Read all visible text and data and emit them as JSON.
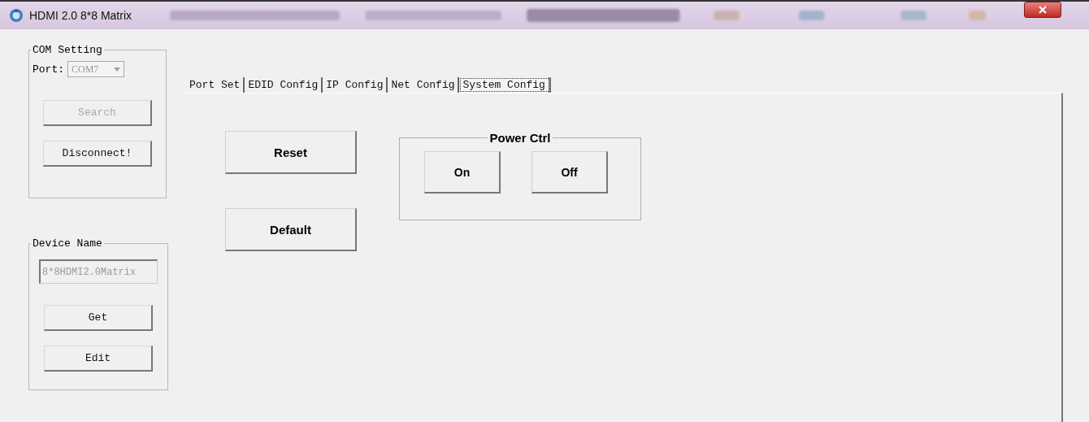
{
  "window": {
    "title": "HDMI 2.0 8*8 Matrix"
  },
  "com_setting": {
    "title": "COM Setting",
    "port_label": "Port:",
    "port_value": "COM7",
    "port_disabled": true,
    "buttons": [
      {
        "label": "Search",
        "disabled": true
      },
      {
        "label": "Disconnect!",
        "disabled": false
      }
    ]
  },
  "device_name": {
    "title": "Device Name",
    "value": "8*8HDMI2.0Matrix",
    "disabled": true,
    "buttons": [
      {
        "label": "Get",
        "disabled": false
      },
      {
        "label": "Edit",
        "disabled": false
      }
    ]
  },
  "tabs": [
    {
      "label": "Port Set",
      "selected": false
    },
    {
      "label": "EDID Config",
      "selected": false
    },
    {
      "label": "IP Config",
      "selected": false
    },
    {
      "label": "Net Config",
      "selected": false
    },
    {
      "label": "System Config",
      "selected": true
    }
  ],
  "system_config": {
    "buttons": [
      {
        "label": "Reset"
      },
      {
        "label": "Default"
      }
    ],
    "power_ctrl": {
      "title": "Power Ctrl",
      "buttons": [
        {
          "label": "On"
        },
        {
          "label": "Off"
        }
      ]
    }
  }
}
